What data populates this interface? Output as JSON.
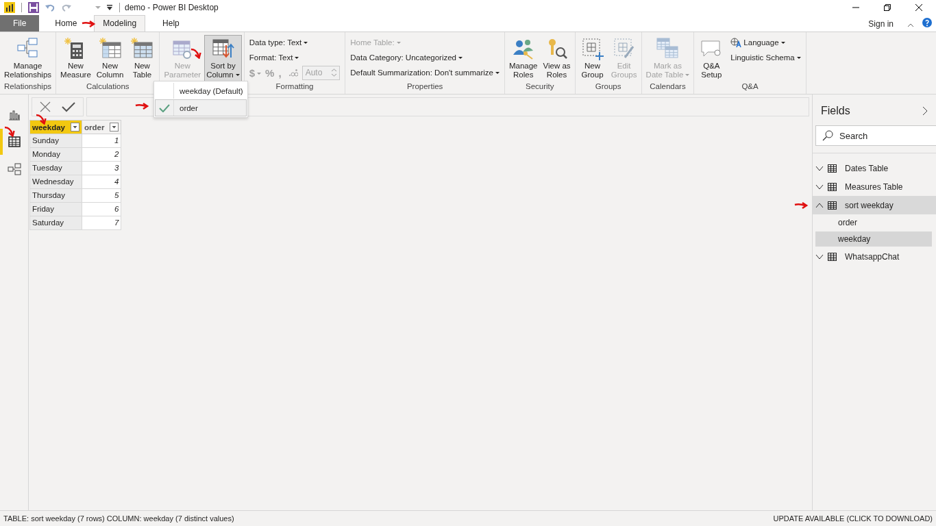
{
  "window": {
    "title": "demo - Power BI Desktop",
    "sign_in": "Sign in"
  },
  "tabs": [
    {
      "label": "File",
      "kind": "file",
      "selected": false
    },
    {
      "label": "Home",
      "kind": "tab",
      "selected": false
    },
    {
      "label": "Modeling",
      "kind": "tab",
      "selected": true
    },
    {
      "label": "Help",
      "kind": "tab",
      "selected": false
    }
  ],
  "ribbon": {
    "groups": [
      {
        "label": "Relationships",
        "items": [
          {
            "kind": "large",
            "label": "Manage\nRelationships",
            "disabled": false
          }
        ]
      },
      {
        "label": "Calculations",
        "items": [
          {
            "kind": "large",
            "label": "New\nMeasure",
            "disabled": false
          },
          {
            "kind": "large",
            "label": "New\nColumn",
            "disabled": false
          },
          {
            "kind": "large",
            "label": "New\nTable",
            "disabled": false
          }
        ]
      },
      {
        "items": [
          {
            "kind": "large",
            "label": "New\nParameter",
            "disabled": true
          },
          {
            "kind": "large",
            "label": "Sort by\nColumn",
            "disabled": false,
            "pressed": true,
            "dropdown": true
          }
        ]
      },
      {
        "label": "Formatting",
        "items": [
          {
            "kind": "small",
            "label": "Data type: Text",
            "disabled": false,
            "dropdown": true
          },
          {
            "kind": "small",
            "label": "Format: Text",
            "disabled": false,
            "dropdown": true
          },
          {
            "kind": "numfmt",
            "symbols": [
              "$",
              "%",
              ","
            ],
            "value": "Auto",
            "disabled": true
          }
        ]
      },
      {
        "label": "Properties",
        "items": [
          {
            "kind": "small",
            "label": "Home Table:",
            "disabled": true,
            "dropdown": true
          },
          {
            "kind": "small",
            "label": "Data Category: Uncategorized",
            "disabled": false,
            "dropdown": true
          },
          {
            "kind": "small",
            "label": "Default Summarization: Don't summarize",
            "disabled": false,
            "dropdown": true
          }
        ]
      },
      {
        "label": "Security",
        "items": [
          {
            "kind": "large",
            "label": "Manage\nRoles",
            "disabled": false
          },
          {
            "kind": "large",
            "label": "View as\nRoles",
            "disabled": false
          }
        ]
      },
      {
        "label": "Groups",
        "items": [
          {
            "kind": "large",
            "label": "New\nGroup",
            "disabled": false
          },
          {
            "kind": "large",
            "label": "Edit\nGroups",
            "disabled": true
          }
        ]
      },
      {
        "label": "Calendars",
        "items": [
          {
            "kind": "large",
            "label": "Mark as\nDate Table",
            "disabled": true,
            "dropdown": true
          }
        ]
      },
      {
        "label": "Q&A",
        "items": [
          {
            "kind": "large",
            "label": "Q&A\nSetup",
            "disabled": false
          },
          {
            "kind": "stack",
            "entries": [
              {
                "label": "Language",
                "dropdown": true
              },
              {
                "label": "Linguistic Schema",
                "dropdown": true
              }
            ]
          }
        ]
      }
    ]
  },
  "sort_menu": [
    {
      "label": "weekday (Default)",
      "selected": false
    },
    {
      "label": "order",
      "selected": true
    }
  ],
  "views": [
    {
      "selected": false
    },
    {
      "selected": true
    },
    {
      "selected": false
    }
  ],
  "table": {
    "columns": [
      {
        "label": "weekday",
        "selected": true
      },
      {
        "label": "order",
        "selected": false
      }
    ],
    "rows": [
      [
        "Sunday",
        "1"
      ],
      [
        "Monday",
        "2"
      ],
      [
        "Tuesday",
        "3"
      ],
      [
        "Wednesday",
        "4"
      ],
      [
        "Thursday",
        "5"
      ],
      [
        "Friday",
        "6"
      ],
      [
        "Saturday",
        "7"
      ]
    ]
  },
  "fields": {
    "title": "Fields",
    "search": {
      "placeholder": "Search"
    },
    "tables": [
      {
        "label": "Dates Table",
        "expanded": false,
        "selected": false
      },
      {
        "label": "Measures Table",
        "expanded": false,
        "selected": false
      },
      {
        "label": "sort weekday",
        "expanded": true,
        "selected": true,
        "children": [
          {
            "label": "order",
            "selected": false
          },
          {
            "label": "weekday",
            "selected": true
          }
        ]
      },
      {
        "label": "WhatsappChat",
        "expanded": false,
        "selected": false
      }
    ]
  },
  "status_bar": {
    "left": "TABLE: sort weekday (7 rows) COLUMN: weekday (7 distinct values)",
    "right": "UPDATE AVAILABLE (CLICK TO DOWNLOAD)"
  }
}
